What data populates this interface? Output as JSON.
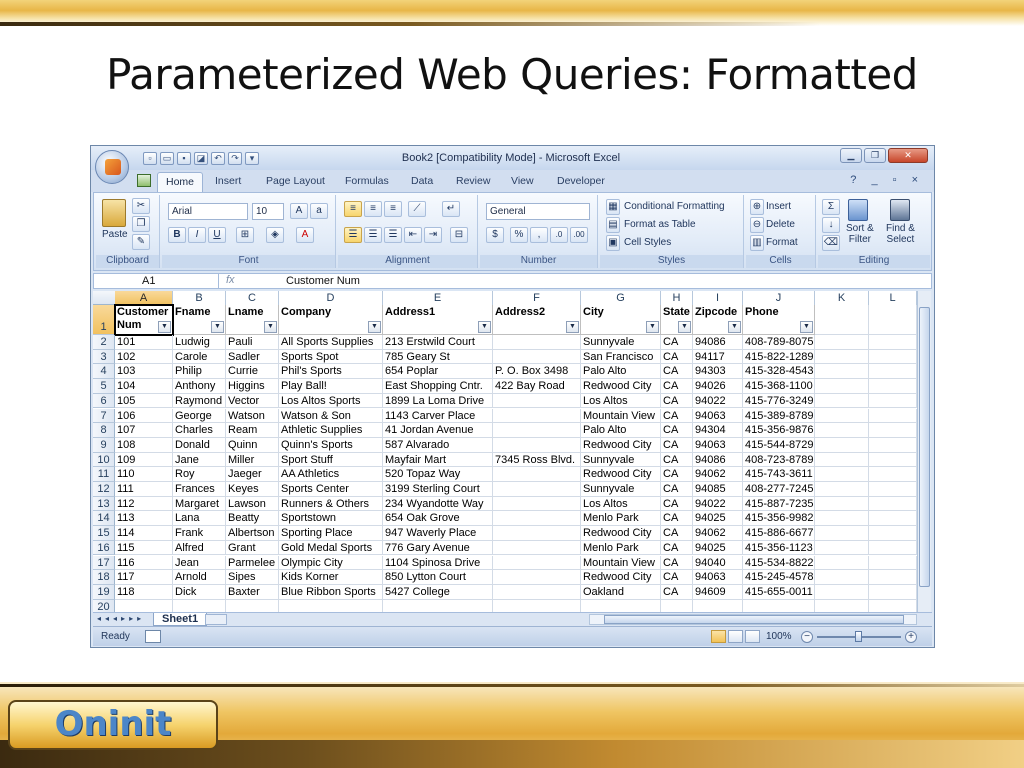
{
  "slide": {
    "title": "Parameterized Web Queries: Formatted",
    "logo_text": "Oninit"
  },
  "window": {
    "title": "Book2  [Compatibility Mode] - Microsoft Excel",
    "controls": [
      "minimize",
      "restore",
      "close"
    ],
    "help_controls": "? _ ▫ ×"
  },
  "tabs": [
    "Home",
    "Insert",
    "Page Layout",
    "Formulas",
    "Data",
    "Review",
    "View",
    "Developer"
  ],
  "active_tab": "Home",
  "ribbon": {
    "clipboard": {
      "label": "Clipboard",
      "paste": "Paste"
    },
    "font": {
      "label": "Font",
      "name": "Arial",
      "size": "10",
      "bold": "B",
      "italic": "I",
      "underline": "U"
    },
    "alignment": {
      "label": "Alignment"
    },
    "number": {
      "label": "Number",
      "format": "General",
      "percent": "%",
      "comma": ","
    },
    "styles": {
      "label": "Styles",
      "conditional": "Conditional Formatting",
      "format_table": "Format as Table",
      "cell_styles": "Cell Styles"
    },
    "cells": {
      "label": "Cells",
      "insert": "Insert",
      "delete": "Delete",
      "format": "Format"
    },
    "editing": {
      "label": "Editing",
      "sort_filter": "Sort &\nFilter",
      "find_select": "Find &\nSelect",
      "sigma": "Σ"
    }
  },
  "formula_bar": {
    "name_box": "A1",
    "fx": "fx",
    "value": "Customer Num"
  },
  "columns": [
    "A",
    "B",
    "C",
    "D",
    "E",
    "F",
    "G",
    "H",
    "I",
    "J",
    "K",
    "L"
  ],
  "header_row": {
    "row_number": "1",
    "cells": [
      "Customer\nNum",
      "Fname",
      "Lname",
      "Company",
      "Address1",
      "Address2",
      "City",
      "State",
      "Zipcode",
      "Phone"
    ]
  },
  "rows": [
    [
      "2",
      "101",
      "Ludwig",
      "Pauli",
      "All Sports Supplies",
      "213 Erstwild Court",
      "",
      "Sunnyvale",
      "CA",
      "94086",
      "408-789-8075"
    ],
    [
      "3",
      "102",
      "Carole",
      "Sadler",
      "Sports Spot",
      "785 Geary St",
      "",
      "San Francisco",
      "CA",
      "94117",
      "415-822-1289"
    ],
    [
      "4",
      "103",
      "Philip",
      "Currie",
      "Phil's Sports",
      "654 Poplar",
      "P. O. Box 3498",
      "Palo Alto",
      "CA",
      "94303",
      "415-328-4543"
    ],
    [
      "5",
      "104",
      "Anthony",
      "Higgins",
      "Play Ball!",
      "East Shopping Cntr.",
      "422 Bay Road",
      "Redwood City",
      "CA",
      "94026",
      "415-368-1100"
    ],
    [
      "6",
      "105",
      "Raymond",
      "Vector",
      "Los Altos Sports",
      "1899 La Loma Drive",
      "",
      "Los Altos",
      "CA",
      "94022",
      "415-776-3249"
    ],
    [
      "7",
      "106",
      "George",
      "Watson",
      "Watson & Son",
      "1143 Carver Place",
      "",
      "Mountain View",
      "CA",
      "94063",
      "415-389-8789"
    ],
    [
      "8",
      "107",
      "Charles",
      "Ream",
      "Athletic Supplies",
      "41 Jordan Avenue",
      "",
      "Palo Alto",
      "CA",
      "94304",
      "415-356-9876"
    ],
    [
      "9",
      "108",
      "Donald",
      "Quinn",
      "Quinn's Sports",
      "587 Alvarado",
      "",
      "Redwood City",
      "CA",
      "94063",
      "415-544-8729"
    ],
    [
      "10",
      "109",
      "Jane",
      "Miller",
      "Sport Stuff",
      "Mayfair Mart",
      "7345 Ross Blvd.",
      "Sunnyvale",
      "CA",
      "94086",
      "408-723-8789"
    ],
    [
      "11",
      "110",
      "Roy",
      "Jaeger",
      "AA Athletics",
      "520 Topaz Way",
      "",
      "Redwood City",
      "CA",
      "94062",
      "415-743-3611"
    ],
    [
      "12",
      "111",
      "Frances",
      "Keyes",
      "Sports Center",
      "3199 Sterling Court",
      "",
      "Sunnyvale",
      "CA",
      "94085",
      "408-277-7245"
    ],
    [
      "13",
      "112",
      "Margaret",
      "Lawson",
      "Runners & Others",
      "234 Wyandotte Way",
      "",
      "Los Altos",
      "CA",
      "94022",
      "415-887-7235"
    ],
    [
      "14",
      "113",
      "Lana",
      "Beatty",
      "Sportstown",
      "654 Oak Grove",
      "",
      "Menlo Park",
      "CA",
      "94025",
      "415-356-9982"
    ],
    [
      "15",
      "114",
      "Frank",
      "Albertson",
      "Sporting Place",
      "947 Waverly Place",
      "",
      "Redwood City",
      "CA",
      "94062",
      "415-886-6677"
    ],
    [
      "16",
      "115",
      "Alfred",
      "Grant",
      "Gold Medal Sports",
      "776 Gary Avenue",
      "",
      "Menlo Park",
      "CA",
      "94025",
      "415-356-1123"
    ],
    [
      "17",
      "116",
      "Jean",
      "Parmelee",
      "Olympic City",
      "1104 Spinosa Drive",
      "",
      "Mountain View",
      "CA",
      "94040",
      "415-534-8822"
    ],
    [
      "18",
      "117",
      "Arnold",
      "Sipes",
      "Kids Korner",
      "850 Lytton Court",
      "",
      "Redwood City",
      "CA",
      "94063",
      "415-245-4578"
    ],
    [
      "19",
      "118",
      "Dick",
      "Baxter",
      "Blue Ribbon Sports",
      "5427 College",
      "",
      "Oakland",
      "CA",
      "94609",
      "415-655-0011"
    ],
    [
      "20",
      "",
      "",
      "",
      "",
      "",
      "",
      "",
      "",
      "",
      ""
    ]
  ],
  "sheet_tab": "Sheet1",
  "status": {
    "text": "Ready",
    "zoom": "100%",
    "zoom_level": 0.5
  }
}
